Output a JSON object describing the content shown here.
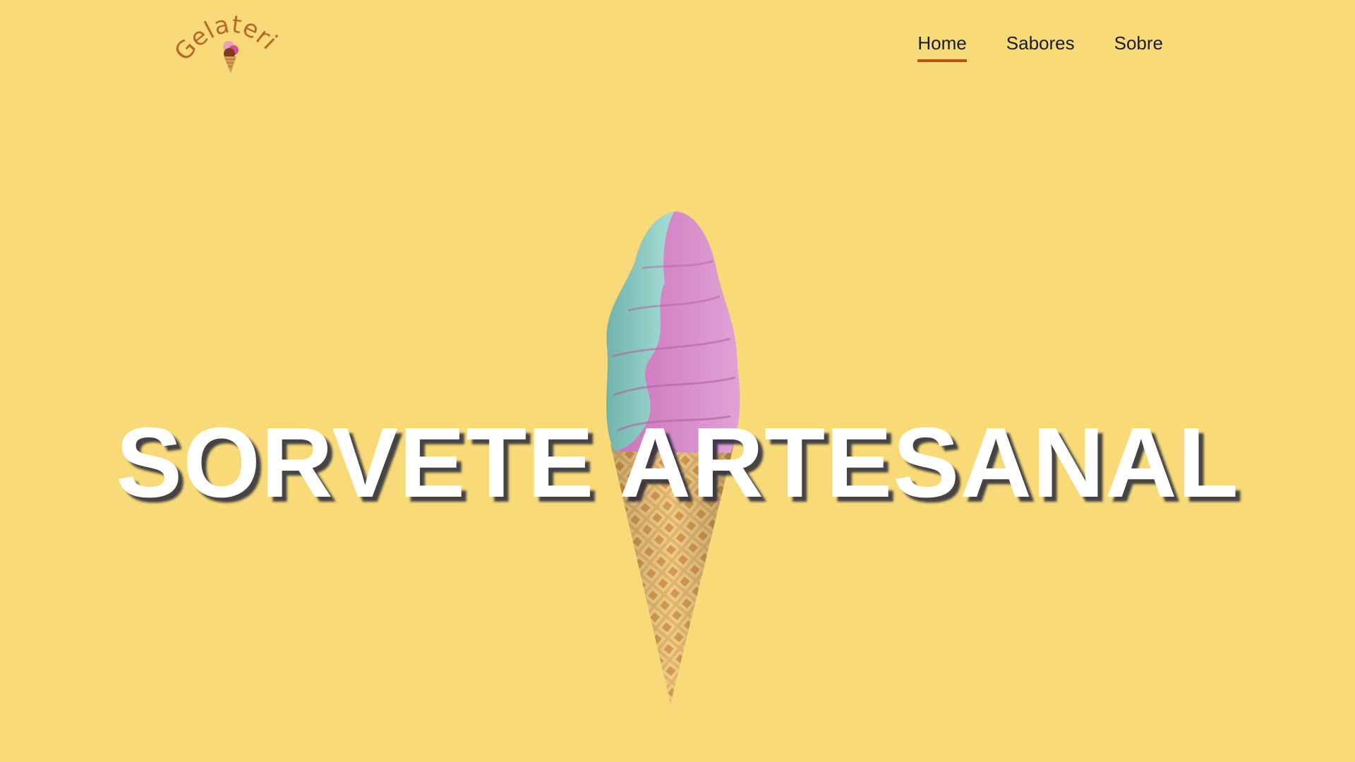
{
  "brand": {
    "logo_text": "Gelateria",
    "logo_color": "#b8682a"
  },
  "nav": {
    "items": [
      {
        "label": "Home",
        "active": true
      },
      {
        "label": "Sabores",
        "active": false
      },
      {
        "label": "Sobre",
        "active": false
      }
    ],
    "active_underline_color": "#b8540f"
  },
  "hero": {
    "headline": "SORVETE ARTESANAL",
    "image": "ice-cream-cone-icon",
    "background_color": "#f8da79"
  }
}
